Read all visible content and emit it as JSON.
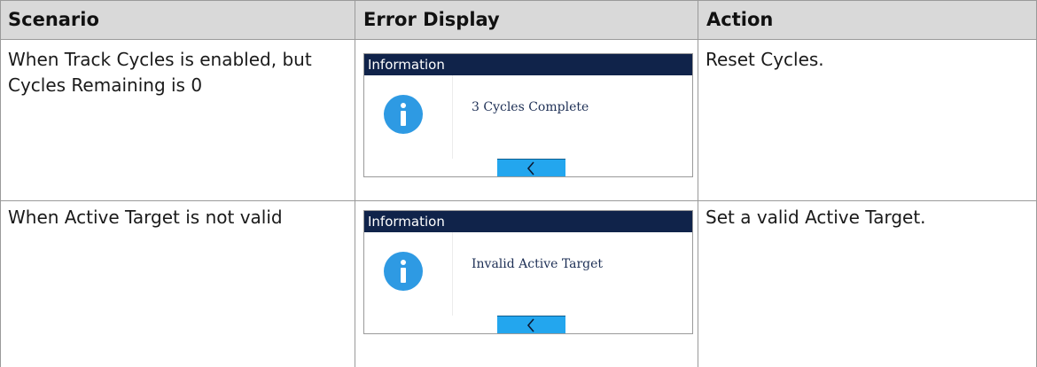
{
  "table": {
    "headers": [
      "Scenario",
      "Error Display",
      "Action"
    ],
    "rows": [
      {
        "scenario_lines": [
          "When Track Cycles is enabled, but",
          "Cycles Remaining is 0"
        ],
        "dialog": {
          "title": "Information",
          "message": "3 Cycles Complete",
          "icon": "info-icon",
          "button_icon": "chevron-left-icon"
        },
        "action": "Reset Cycles."
      },
      {
        "scenario_lines": [
          "When Active Target is not valid"
        ],
        "dialog": {
          "title": "Information",
          "message": "Invalid Active Target",
          "icon": "info-icon",
          "button_icon": "chevron-left-icon"
        },
        "action": "Set a valid Active Target."
      }
    ]
  },
  "colors": {
    "header_bg": "#d9d9d9",
    "dialog_title_bg": "#10234a",
    "info_icon": "#2e9ae3",
    "back_button": "#23a6ee"
  }
}
